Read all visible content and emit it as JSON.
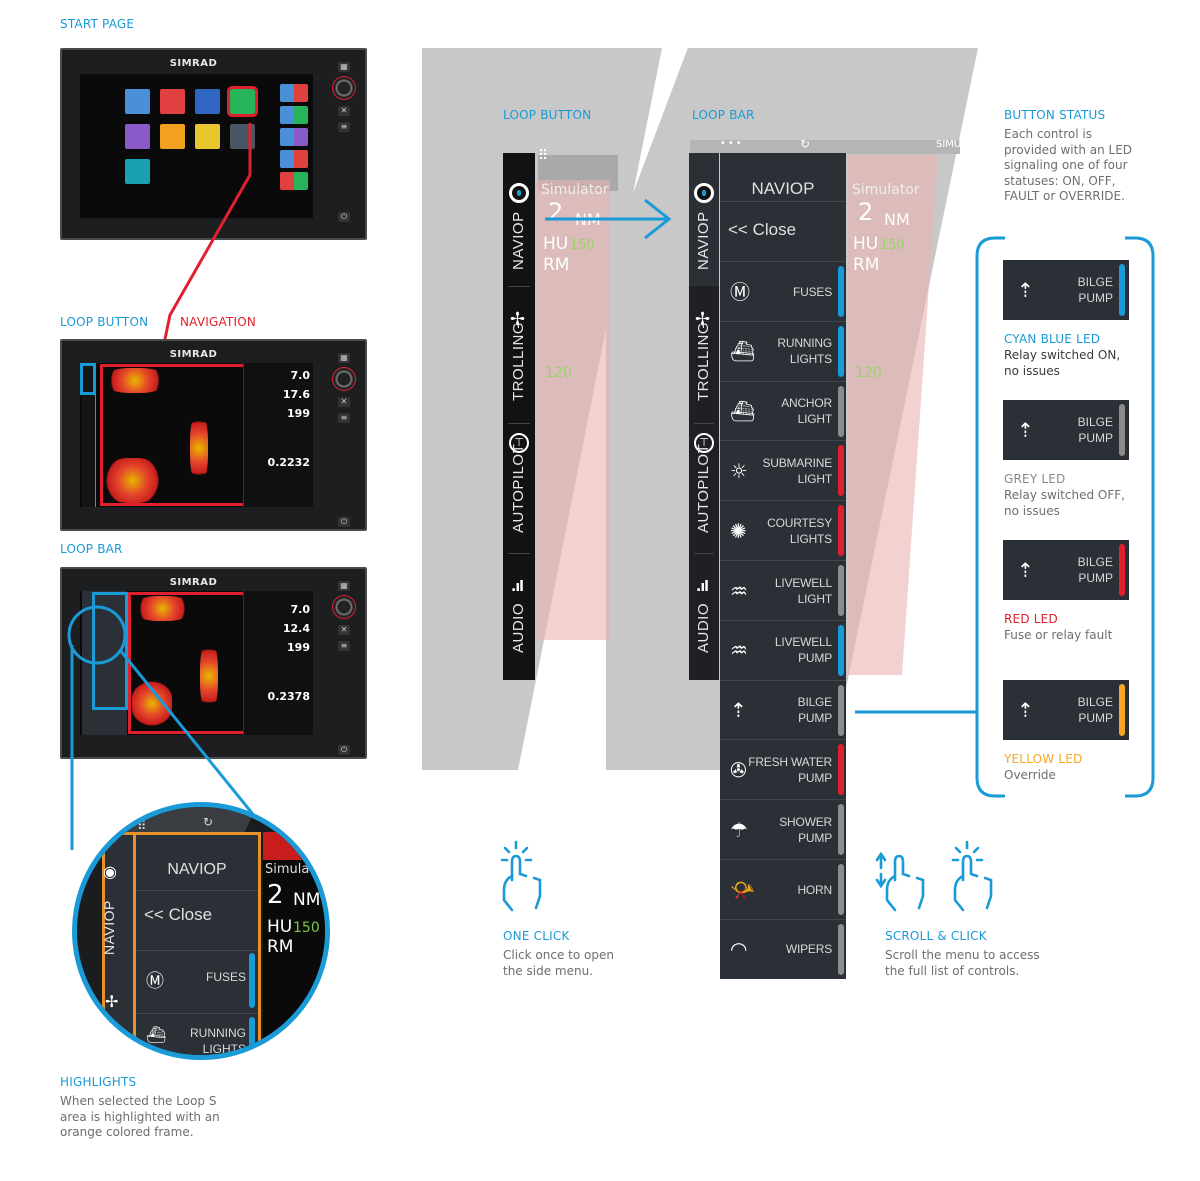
{
  "brand": "SIMRAD",
  "colors": {
    "accent": "#1a9ad6",
    "red": "#e0202d",
    "grey_led": "#8c8c8c",
    "yellow": "#f6a623",
    "orange_frame": "#e8902a",
    "menu_bg": "#2b2f36"
  },
  "left": {
    "start_page": {
      "caption": "START PAGE"
    },
    "loop_button": {
      "caption": "LOOP BUTTON",
      "nav_caption": "NAVIGATION",
      "values": [
        "7.0",
        "17.6",
        "199",
        "0.2232"
      ]
    },
    "loop_bar": {
      "caption": "LOOP BAR",
      "values": [
        "7.0",
        "12.4",
        "199",
        "0.2378"
      ]
    },
    "highlight_zoom": {
      "menu_title": "NAVIOP",
      "close": "<< Close",
      "tab": "NAVIOP",
      "overlay": {
        "sim": "Simulator",
        "range": "2",
        "unit": "NM",
        "hu": "HU",
        "rm": "RM",
        "ring": "150"
      },
      "rows": [
        {
          "label": "FUSES"
        },
        {
          "label": "RUNNING\nLIGHTS"
        }
      ]
    },
    "highlights": {
      "caption": "HIGHLIGHTS",
      "text": "When selected the Loop S area is highlighted with an orange colored frame."
    }
  },
  "middle": {
    "loop_button_panel": {
      "caption": "LOOP BUTTON",
      "tabs": [
        "NAVIOP",
        "TROLLING",
        "AUTOPILOT",
        "AUDIO"
      ],
      "overlay": {
        "sim": "Simulator",
        "range": "2",
        "unit": "NM",
        "hu": "HU",
        "rm": "RM",
        "ring1": "150",
        "ring2": "120"
      }
    },
    "loop_bar_panel": {
      "caption": "LOOP BAR",
      "header_text": "SIMU",
      "tabs": [
        "NAVIOP",
        "TROLLING",
        "AUTOPILOT",
        "AUDIO"
      ],
      "menu_title": "NAVIOP",
      "close": "<< Close",
      "overlay": {
        "sim": "Simulator",
        "range": "2",
        "unit": "NM",
        "hu": "HU",
        "rm": "RM",
        "ring1": "150",
        "ring2": "120"
      },
      "rows": [
        {
          "label": "FUSES",
          "icon": "fuse-icon",
          "led": "cyan"
        },
        {
          "label": "RUNNING LIGHTS",
          "icon": "running-lights-icon",
          "led": "cyan"
        },
        {
          "label": "ANCHOR LIGHT",
          "icon": "anchor-light-icon",
          "led": "grey"
        },
        {
          "label": "SUBMARINE LIGHT",
          "icon": "submarine-light-icon",
          "led": "red"
        },
        {
          "label": "COURTESY LIGHTS",
          "icon": "courtesy-lights-icon",
          "led": "red"
        },
        {
          "label": "LIVEWELL LIGHT",
          "icon": "livewell-light-icon",
          "led": "grey"
        },
        {
          "label": "LIVEWELL PUMP",
          "icon": "livewell-pump-icon",
          "led": "cyan"
        },
        {
          "label": "BILGE PUMP",
          "icon": "bilge-pump-icon",
          "led": "grey"
        },
        {
          "label": "FRESH WATER PUMP",
          "icon": "fresh-water-pump-icon",
          "led": "red"
        },
        {
          "label": "SHOWER PUMP",
          "icon": "shower-pump-icon",
          "led": "grey"
        },
        {
          "label": "HORN",
          "icon": "horn-icon",
          "led": "grey"
        },
        {
          "label": "WIPERS",
          "icon": "wipers-icon",
          "led": "grey"
        }
      ]
    },
    "one_click": {
      "caption": "ONE CLICK",
      "text": "Click once to open the side menu."
    },
    "scroll_click": {
      "caption": "SCROLL & CLICK",
      "text": "Scroll the menu to access the full list of controls."
    }
  },
  "right": {
    "button_status": {
      "caption": "BUTTON STATUS",
      "text": "Each control is provided with an LED signaling one of four statuses: ON, OFF, FAULT or OVERRIDE."
    },
    "cards": [
      {
        "label": "BILGE PUMP",
        "led": "cyan",
        "title": "CYAN BLUE LED",
        "text": "Relay switched ON, no issues"
      },
      {
        "label": "BILGE PUMP",
        "led": "grey",
        "title": "GREY LED",
        "text": "Relay switched OFF, no issues"
      },
      {
        "label": "BILGE PUMP",
        "led": "red",
        "title": "RED LED",
        "text": "Fuse or relay fault"
      },
      {
        "label": "BILGE PUMP",
        "led": "yellow",
        "title": "YELLOW LED",
        "text": "Override"
      }
    ]
  }
}
